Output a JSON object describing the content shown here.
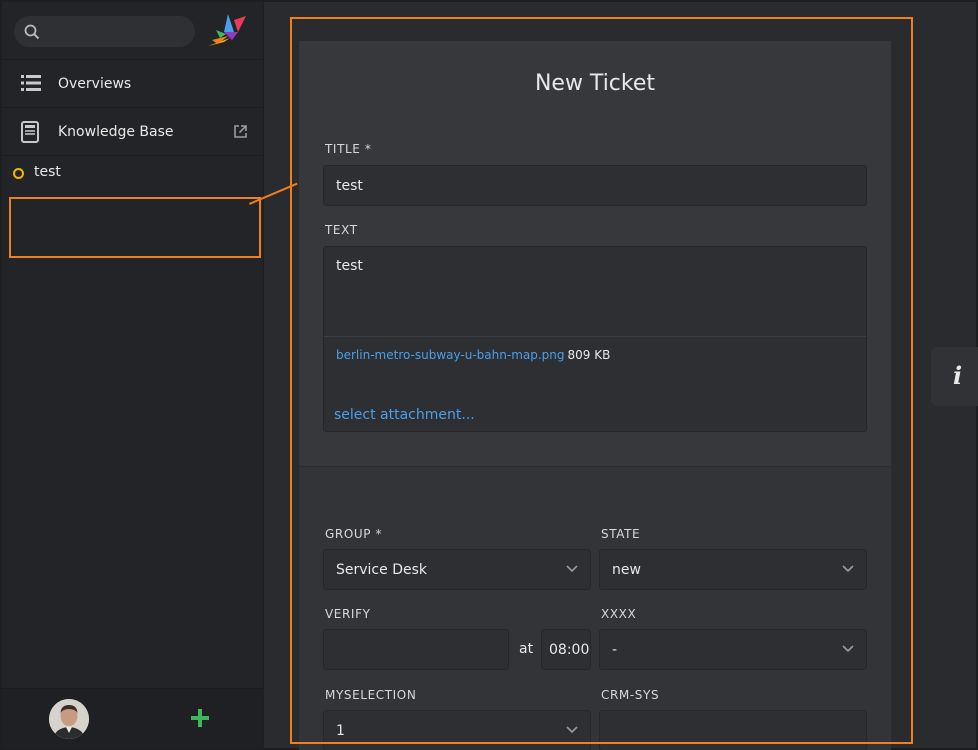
{
  "search": {
    "placeholder": ""
  },
  "nav": {
    "overviews": "Overviews",
    "knowledge_base": "Knowledge Base"
  },
  "tasks": [
    {
      "label": "test"
    }
  ],
  "form": {
    "heading": "New Ticket",
    "title_label": "TITLE *",
    "title_value": "test",
    "text_label": "TEXT",
    "text_value": "test",
    "attachment": {
      "name": "berlin-metro-subway-u-bahn-map.png",
      "size": "809 KB"
    },
    "select_attachment": "select attachment...",
    "group_label": "GROUP *",
    "group_value": "Service Desk",
    "state_label": "STATE",
    "state_value": "new",
    "verify_label": "VERIFY",
    "verify_value": "",
    "at_label": "at",
    "time_value": "08:00",
    "xxxx_label": "XXXX",
    "xxxx_value": "-",
    "myselection_label": "MYSELECTION",
    "myselection_value": "1",
    "crmsys_label": "CRM-SYS",
    "crmsys_value": ""
  },
  "colors": {
    "accent": "#f07f1e",
    "link": "#4a9fe8",
    "task_status": "#f4b400",
    "add": "#3cb95c"
  },
  "icons": [
    "search-icon",
    "app-logo",
    "list-icon",
    "book-icon",
    "external-link-icon",
    "chevron-down-icon",
    "plus-icon",
    "info-icon"
  ]
}
